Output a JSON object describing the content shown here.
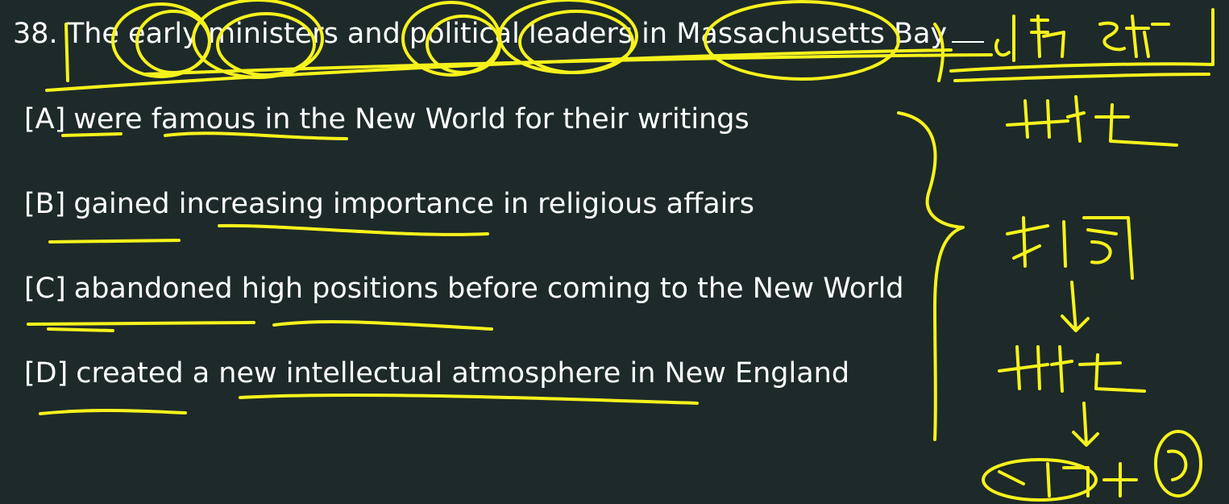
{
  "question": {
    "number": "38.",
    "text": "The early ministers and political leaders in Massachusetts Bay"
  },
  "options": [
    {
      "label": "[A]",
      "text": "were famous in the New World for their writings"
    },
    {
      "label": "[B]",
      "text": "gained increasing importance in religious affairs"
    },
    {
      "label": "[C]",
      "text": "abandoned high positions before coming to the New World"
    },
    {
      "label": "[D]",
      "text": "created a new intellectual atmosphere in New England"
    }
  ],
  "colors": {
    "background": "#1d2a29",
    "text": "#ffffff",
    "annotation_ink": "#f6f21c"
  }
}
